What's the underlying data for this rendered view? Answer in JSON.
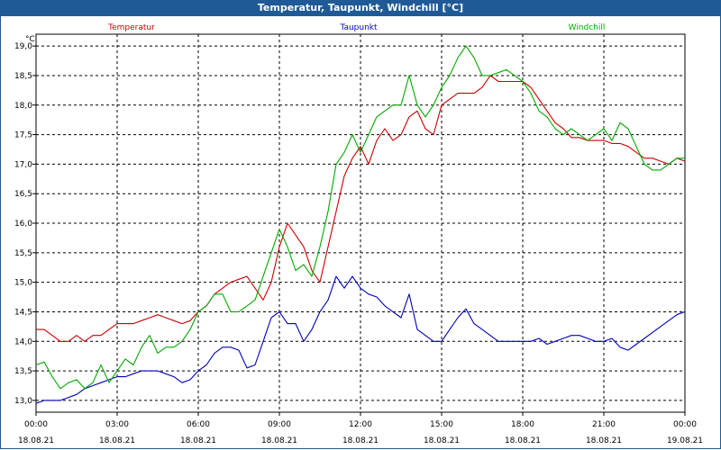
{
  "window": {
    "title": "Temperatur, Taupunkt, Windchill [°C]"
  },
  "chart_data": {
    "type": "line",
    "title": "Temperatur, Taupunkt, Windchill [°C]",
    "ylabel": "°C",
    "ylim": [
      12.8,
      19.2
    ],
    "yticks": [
      13.0,
      13.5,
      14.0,
      14.5,
      15.0,
      15.5,
      16.0,
      16.5,
      17.0,
      17.5,
      18.0,
      18.5,
      19.0
    ],
    "ytick_labels": [
      "13,0",
      "13,5",
      "14,0",
      "14,5",
      "15,0",
      "15,5",
      "16,0",
      "16,5",
      "17,0",
      "17,5",
      "18,0",
      "18,5",
      "19,0"
    ],
    "xlim": [
      0,
      24
    ],
    "xticks": [
      0,
      3,
      6,
      9,
      12,
      15,
      18,
      21,
      24
    ],
    "xtick_times": [
      "00:00",
      "03:00",
      "06:00",
      "09:00",
      "12:00",
      "15:00",
      "18:00",
      "21:00",
      "00:00"
    ],
    "xtick_dates": [
      "18.08.21",
      "18.08.21",
      "18.08.21",
      "18.08.21",
      "18.08.21",
      "18.08.21",
      "18.08.21",
      "18.08.21",
      "19.08.21"
    ],
    "grid": true,
    "legend": "top",
    "series": [
      {
        "name": "Temperatur",
        "color": "#cc0000",
        "x": [
          0,
          0.3,
          0.6,
          0.9,
          1.2,
          1.5,
          1.8,
          2.1,
          2.4,
          2.7,
          3.0,
          3.3,
          3.6,
          3.9,
          4.2,
          4.5,
          4.8,
          5.1,
          5.4,
          5.7,
          6.0,
          6.3,
          6.6,
          6.9,
          7.2,
          7.5,
          7.8,
          8.1,
          8.4,
          8.7,
          9.0,
          9.3,
          9.6,
          9.9,
          10.2,
          10.5,
          10.8,
          11.1,
          11.4,
          11.7,
          12.0,
          12.3,
          12.6,
          12.9,
          13.2,
          13.5,
          13.8,
          14.1,
          14.4,
          14.7,
          15.0,
          15.3,
          15.6,
          15.9,
          16.2,
          16.5,
          16.8,
          17.1,
          17.4,
          17.7,
          18.0,
          18.3,
          18.6,
          18.9,
          19.2,
          19.5,
          19.8,
          20.1,
          20.4,
          20.7,
          21.0,
          21.3,
          21.6,
          21.9,
          22.2,
          22.5,
          22.8,
          23.1,
          23.4,
          23.7,
          24.0
        ],
        "y": [
          14.2,
          14.2,
          14.1,
          14.0,
          14.0,
          14.1,
          14.0,
          14.1,
          14.1,
          14.2,
          14.3,
          14.3,
          14.3,
          14.35,
          14.4,
          14.45,
          14.4,
          14.35,
          14.3,
          14.35,
          14.5,
          14.6,
          14.8,
          14.9,
          15.0,
          15.05,
          15.1,
          14.9,
          14.7,
          15.0,
          15.6,
          16.0,
          15.8,
          15.6,
          15.2,
          15.0,
          15.6,
          16.2,
          16.8,
          17.1,
          17.3,
          17.0,
          17.4,
          17.6,
          17.4,
          17.5,
          17.8,
          17.9,
          17.6,
          17.5,
          18.0,
          18.1,
          18.2,
          18.2,
          18.2,
          18.3,
          18.5,
          18.4,
          18.4,
          18.4,
          18.4,
          18.3,
          18.1,
          17.9,
          17.7,
          17.6,
          17.45,
          17.45,
          17.4,
          17.4,
          17.4,
          17.35,
          17.35,
          17.3,
          17.2,
          17.1,
          17.1,
          17.05,
          17.0,
          17.1,
          17.05
        ]
      },
      {
        "name": "Taupunkt",
        "color": "#0000bb",
        "x": [
          0,
          0.3,
          0.6,
          0.9,
          1.2,
          1.5,
          1.8,
          2.1,
          2.4,
          2.7,
          3.0,
          3.3,
          3.6,
          3.9,
          4.2,
          4.5,
          4.8,
          5.1,
          5.4,
          5.7,
          6.0,
          6.3,
          6.6,
          6.9,
          7.2,
          7.5,
          7.8,
          8.1,
          8.4,
          8.7,
          9.0,
          9.3,
          9.6,
          9.9,
          10.2,
          10.5,
          10.8,
          11.1,
          11.4,
          11.7,
          12.0,
          12.3,
          12.6,
          12.9,
          13.2,
          13.5,
          13.8,
          14.1,
          14.4,
          14.7,
          15.0,
          15.3,
          15.6,
          15.9,
          16.2,
          16.5,
          16.8,
          17.1,
          17.4,
          17.7,
          18.0,
          18.3,
          18.6,
          18.9,
          19.2,
          19.5,
          19.8,
          20.1,
          20.4,
          20.7,
          21.0,
          21.3,
          21.6,
          21.9,
          22.2,
          22.5,
          22.8,
          23.1,
          23.4,
          23.7,
          24.0
        ],
        "y": [
          12.95,
          13.0,
          13.0,
          13.0,
          13.05,
          13.1,
          13.2,
          13.25,
          13.3,
          13.35,
          13.4,
          13.4,
          13.45,
          13.5,
          13.5,
          13.5,
          13.45,
          13.4,
          13.3,
          13.35,
          13.5,
          13.6,
          13.8,
          13.9,
          13.9,
          13.85,
          13.55,
          13.6,
          14.0,
          14.4,
          14.5,
          14.3,
          14.3,
          14.0,
          14.2,
          14.5,
          14.7,
          15.1,
          14.9,
          15.1,
          14.9,
          14.8,
          14.75,
          14.6,
          14.5,
          14.4,
          14.8,
          14.2,
          14.1,
          14.0,
          14.0,
          14.2,
          14.4,
          14.55,
          14.3,
          14.2,
          14.1,
          14.0,
          14.0,
          14.0,
          14.0,
          14.0,
          14.05,
          13.95,
          14.0,
          14.05,
          14.1,
          14.1,
          14.05,
          14.0,
          14.0,
          14.05,
          13.9,
          13.85,
          13.95,
          14.05,
          14.15,
          14.25,
          14.35,
          14.45,
          14.5
        ]
      },
      {
        "name": "Windchill",
        "color": "#00aa00",
        "x": [
          0,
          0.3,
          0.6,
          0.9,
          1.2,
          1.5,
          1.8,
          2.1,
          2.4,
          2.7,
          3.0,
          3.3,
          3.6,
          3.9,
          4.2,
          4.5,
          4.8,
          5.1,
          5.4,
          5.7,
          6.0,
          6.3,
          6.6,
          6.9,
          7.2,
          7.5,
          7.8,
          8.1,
          8.4,
          8.7,
          9.0,
          9.3,
          9.6,
          9.9,
          10.2,
          10.5,
          10.8,
          11.1,
          11.4,
          11.7,
          12.0,
          12.3,
          12.6,
          12.9,
          13.2,
          13.5,
          13.8,
          14.1,
          14.4,
          14.7,
          15.0,
          15.3,
          15.6,
          15.9,
          16.2,
          16.5,
          16.8,
          17.1,
          17.4,
          17.7,
          18.0,
          18.3,
          18.6,
          18.9,
          19.2,
          19.5,
          19.8,
          20.1,
          20.4,
          20.7,
          21.0,
          21.3,
          21.6,
          21.9,
          22.2,
          22.5,
          22.8,
          23.1,
          23.4,
          23.7,
          24.0
        ],
        "y": [
          13.6,
          13.65,
          13.4,
          13.2,
          13.3,
          13.35,
          13.2,
          13.3,
          13.6,
          13.3,
          13.5,
          13.7,
          13.6,
          13.9,
          14.1,
          13.8,
          13.9,
          13.9,
          14.0,
          14.2,
          14.5,
          14.6,
          14.8,
          14.8,
          14.5,
          14.5,
          14.6,
          14.7,
          15.1,
          15.5,
          15.9,
          15.6,
          15.2,
          15.3,
          15.1,
          15.6,
          16.2,
          17.0,
          17.2,
          17.5,
          17.2,
          17.5,
          17.8,
          17.9,
          18.0,
          18.0,
          18.5,
          18.0,
          17.8,
          18.0,
          18.3,
          18.5,
          18.8,
          19.0,
          18.8,
          18.5,
          18.5,
          18.55,
          18.6,
          18.5,
          18.4,
          18.2,
          17.9,
          17.8,
          17.6,
          17.5,
          17.6,
          17.5,
          17.4,
          17.5,
          17.6,
          17.4,
          17.7,
          17.6,
          17.3,
          17.0,
          16.9,
          16.9,
          17.0,
          17.1,
          17.1
        ]
      }
    ]
  }
}
